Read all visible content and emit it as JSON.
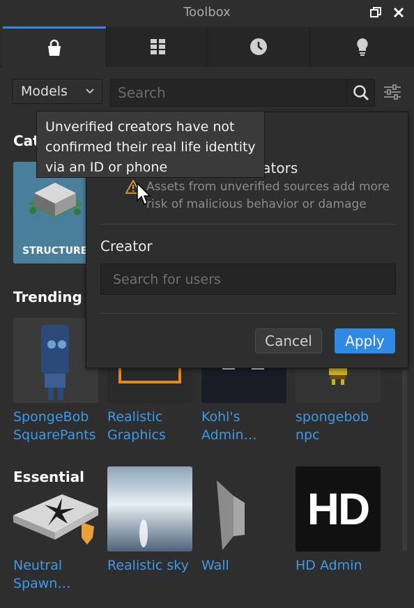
{
  "window": {
    "title": "Toolbox"
  },
  "tabs": [
    {
      "name": "Marketplace",
      "icon": "shopping-bag-icon"
    },
    {
      "name": "Inventory",
      "icon": "grid-icon"
    },
    {
      "name": "Recent",
      "icon": "clock-icon"
    },
    {
      "name": "Creations",
      "icon": "lightbulb-icon"
    }
  ],
  "toolbar": {
    "category_value": "Models",
    "search_placeholder": "Search"
  },
  "sections": {
    "categories_partial": "Cat",
    "categories_thumb_label": "STRUCTURE",
    "trending": "Trending",
    "essential": "Essential"
  },
  "trending_items": [
    {
      "label": "SpongeBob SquarePants"
    },
    {
      "label": "Realistic Graphics"
    },
    {
      "label": "Kohl's Admin…"
    },
    {
      "label": "spongebob npc"
    }
  ],
  "essential_items": [
    {
      "label": "Neutral Spawn…"
    },
    {
      "label": "Realistic sky"
    },
    {
      "label": "Wall"
    },
    {
      "label": "HD Admin",
      "thumb_text": "HD"
    }
  ],
  "filter_popup": {
    "heading_partial": "eators",
    "warning_text": "Assets from unverified sources add more risk of malicious behavior or damage",
    "creator_label": "Creator",
    "creator_placeholder": "Search for users",
    "cancel_label": "Cancel",
    "apply_label": "Apply"
  },
  "tooltip": {
    "text": "Unverified creators have not confirmed their real life identity via an ID or phone"
  },
  "colors": {
    "accent": "#2f8ae6",
    "link": "#3d9ae8",
    "background": "#2e2e2e",
    "warning": "#e0a03a"
  }
}
